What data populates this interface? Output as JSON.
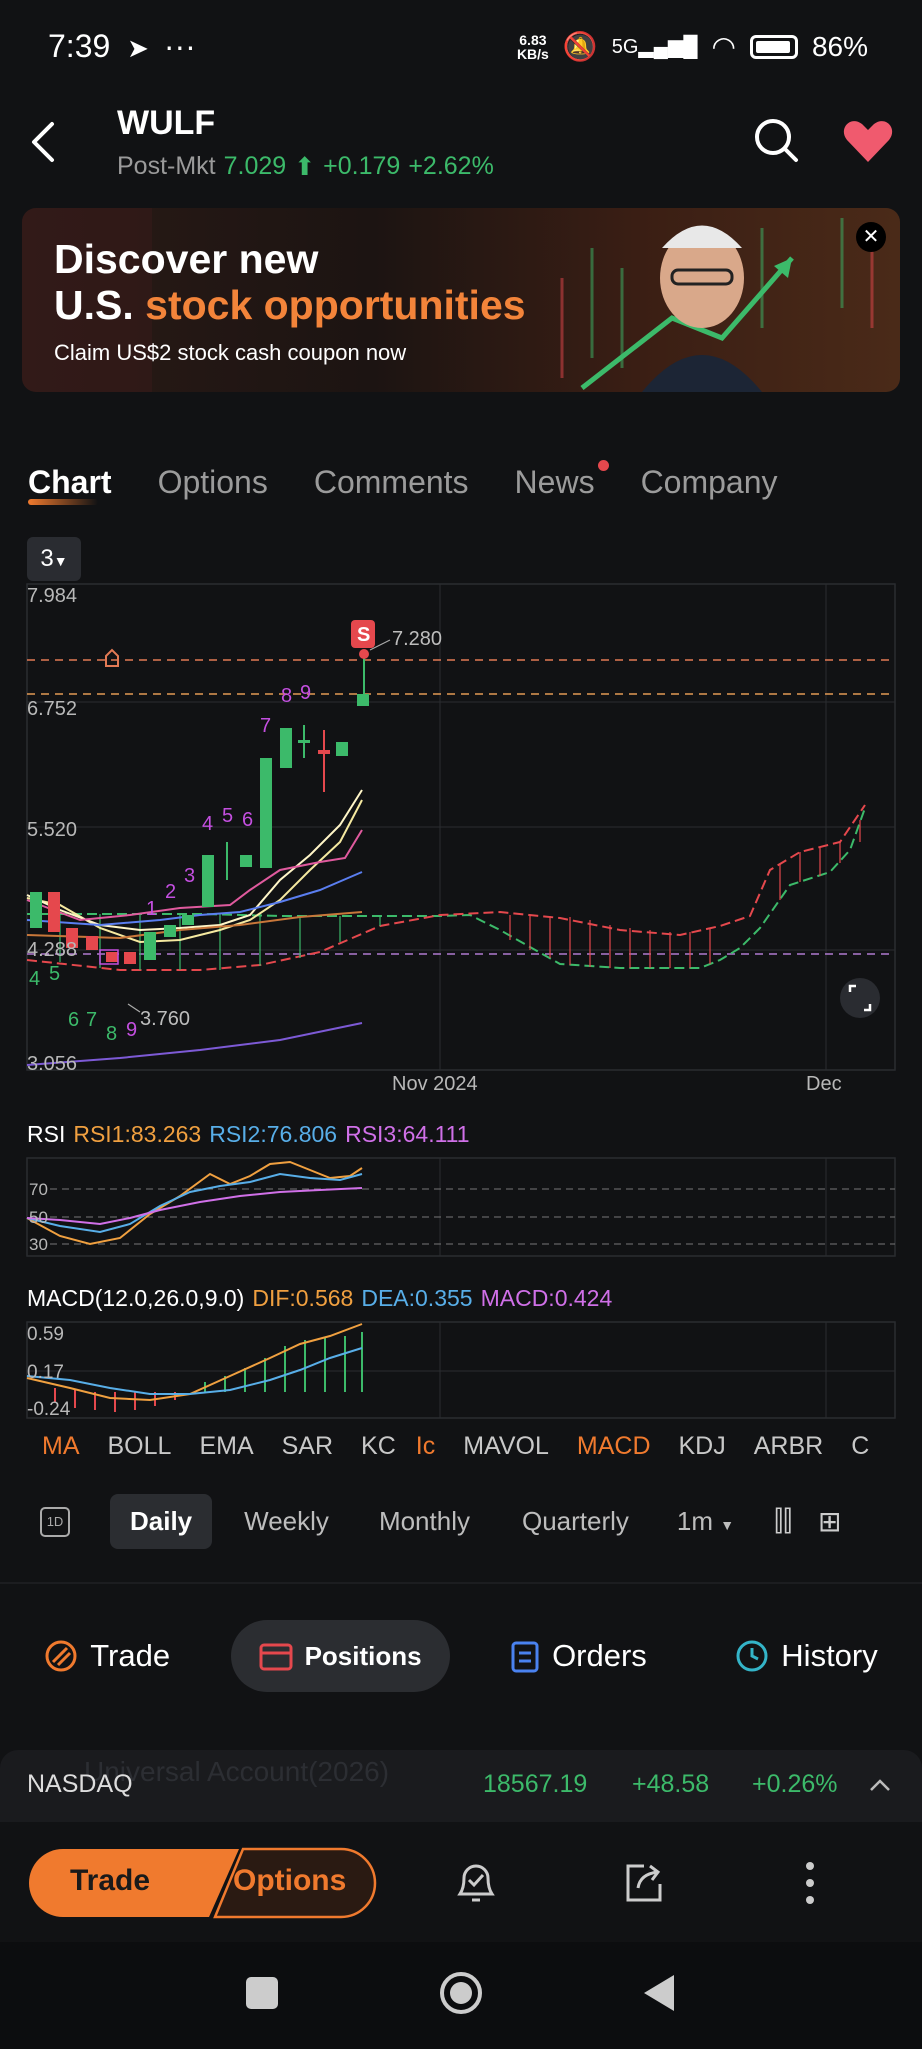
{
  "status_bar": {
    "time": "7:39",
    "net_speed_value": "6.83",
    "net_speed_unit": "KB/s",
    "network": "5G",
    "battery": "86%"
  },
  "header": {
    "ticker": "WULF",
    "session": "Post-Mkt",
    "price": "7.029",
    "change": "+0.179",
    "change_pct": "+2.62%"
  },
  "banner": {
    "line1": "Discover new",
    "line2_a": "U.S. ",
    "line2_b": "stock opportunities",
    "line3": "Claim US$2 stock cash coupon now"
  },
  "tabs": [
    "Chart",
    "Options",
    "Comments",
    "News",
    "Company"
  ],
  "chart": {
    "range_chip": "3",
    "price_labels": [
      "7.984",
      "6.752",
      "5.520",
      "4.288",
      "3.056"
    ],
    "sell_marker": "S",
    "high_label": "7.280",
    "low_label": "3.760",
    "date_labels": [
      "Nov 2024",
      "Dec"
    ],
    "count_labels_up": [
      "1",
      "2",
      "3",
      "4",
      "5",
      "6",
      "7",
      "8",
      "9"
    ],
    "count_labels_down": [
      "4",
      "5",
      "6",
      "7",
      "8",
      "9"
    ]
  },
  "rsi": {
    "title": "RSI",
    "rsi1": "RSI1:83.263",
    "rsi2": "RSI2:76.806",
    "rsi3": "RSI3:64.111",
    "levels": [
      "70",
      "50",
      "30"
    ]
  },
  "macd": {
    "title": "MACD(12.0,26.0,9.0)",
    "dif": "DIF:0.568",
    "dea": "DEA:0.355",
    "macd": "MACD:0.424",
    "levels": [
      "0.59",
      "0.17",
      "-0.24"
    ]
  },
  "indicators": [
    "MA",
    "BOLL",
    "EMA",
    "SAR",
    "KC",
    "Ic",
    "MAVOL",
    "MACD",
    "KDJ",
    "ARBR",
    "C"
  ],
  "periods": {
    "icon_label": "1D",
    "daily": "Daily",
    "weekly": "Weekly",
    "monthly": "Monthly",
    "quarterly": "Quarterly",
    "minute": "1m"
  },
  "actions": {
    "trade": "Trade",
    "positions": "Positions",
    "orders": "Orders",
    "history": "History"
  },
  "account_ghost": "Universal Account(2026)",
  "index_bar": {
    "name": "NASDAQ",
    "value": "18567.19",
    "change": "+48.58",
    "change_pct": "+0.26%"
  },
  "bottom": {
    "trade": "Trade",
    "options": "Options"
  },
  "colors": {
    "accent": "#f07a2e",
    "up": "#3cba6a",
    "down": "#e5484d",
    "background": "#111214"
  }
}
